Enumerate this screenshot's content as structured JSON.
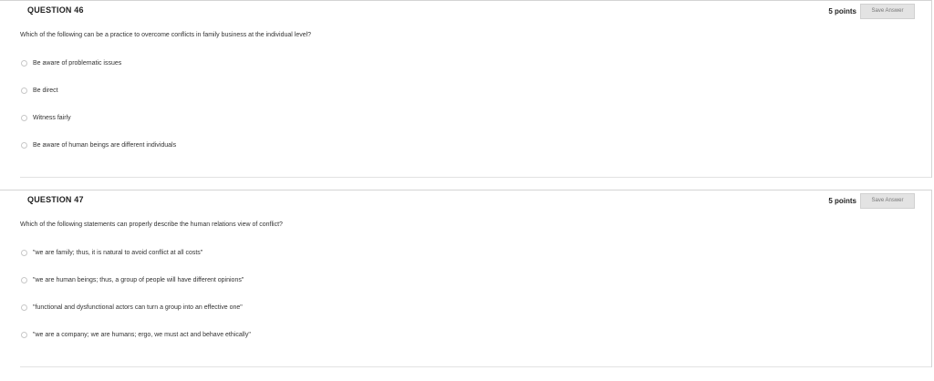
{
  "questions": [
    {
      "title": "QUESTION 46",
      "points": "5 points",
      "save_label": "Save Answer",
      "text": "Which of the following can be a practice to overcome conflicts in family business at the individual level?",
      "options": [
        "Be aware of problematic issues",
        "Be direct",
        "Witness fairly",
        "Be aware of human beings are different individuals"
      ]
    },
    {
      "title": "QUESTION 47",
      "points": "5 points",
      "save_label": "Save Answer",
      "text": "Which of the following statements can properly describe the human relations view of conflict?",
      "options": [
        "\"we are family; thus, it is natural to avoid conflict at all costs\"",
        "\"we are human beings; thus, a group of people will have different opinions\"",
        "\"functional and dysfunctional actors can turn a group into an effective one\"",
        "\"we are a company; we are humans; ergo, we must act and behave ethically\""
      ]
    }
  ]
}
